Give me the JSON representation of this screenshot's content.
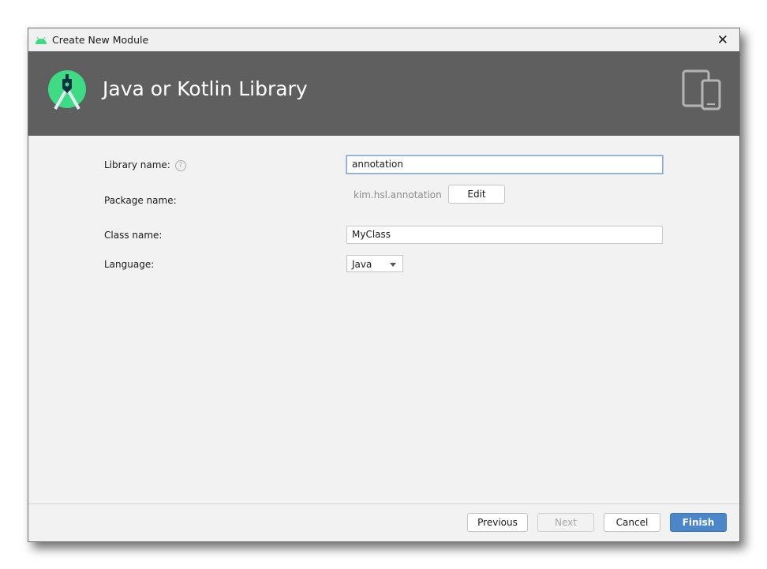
{
  "window": {
    "title": "Create New Module",
    "close_icon": "close-icon"
  },
  "header": {
    "title": "Java or Kotlin Library",
    "logo": "android-studio-logo",
    "device_icon": "tablet-phone-icon"
  },
  "form": {
    "library_name": {
      "label": "Library name:",
      "value": "annotation",
      "help": "?"
    },
    "package_name": {
      "label": "Package name:",
      "value": "kim.hsl.annotation",
      "edit_label": "Edit"
    },
    "class_name": {
      "label": "Class name:",
      "value": "MyClass"
    },
    "language": {
      "label": "Language:",
      "value": "Java"
    }
  },
  "footer": {
    "previous": "Previous",
    "next": "Next",
    "cancel": "Cancel",
    "finish": "Finish"
  },
  "colors": {
    "accent": "#4a86c8",
    "header_bg": "#5f5f5f",
    "android_green": "#3ddc84"
  }
}
